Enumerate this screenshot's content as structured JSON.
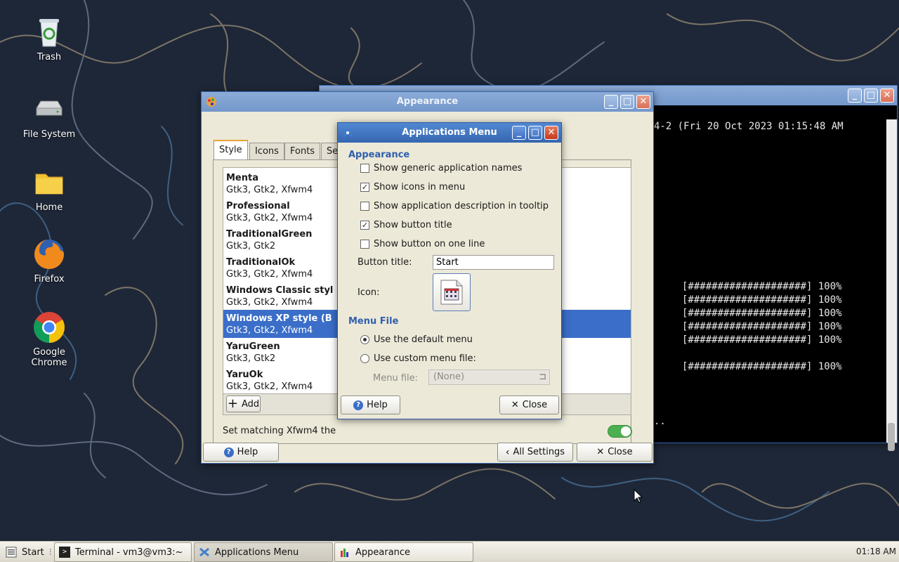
{
  "desktop": {
    "icons": [
      {
        "label": "Trash",
        "icon": "trash-icon"
      },
      {
        "label": "File System",
        "icon": "drive-icon"
      },
      {
        "label": "Home",
        "icon": "folder-icon"
      },
      {
        "label": "Firefox",
        "icon": "firefox-icon"
      },
      {
        "label": "Google Chrome",
        "icon": "chrome-icon"
      }
    ]
  },
  "terminal": {
    "header_line": "4-2 (Fri 20 Oct 2023 01:15:48 AM",
    "progress_lines": [
      "[####################] 100%",
      "[####################] 100%",
      "[####################] 100%",
      "[####################] 100%",
      "[####################] 100%"
    ],
    "progress_line_last": "[####################] 100%",
    "ellipsis": ".."
  },
  "appearance": {
    "title": "Appearance",
    "tabs": [
      "Style",
      "Icons",
      "Fonts",
      "Se"
    ],
    "themes": [
      {
        "name": "Menta",
        "sub": "Gtk3, Gtk2, Xfwm4"
      },
      {
        "name": "Professional",
        "sub": "Gtk3, Gtk2, Xfwm4"
      },
      {
        "name": "TraditionalGreen",
        "sub": "Gtk3, Gtk2"
      },
      {
        "name": "TraditionalOk",
        "sub": "Gtk3, Gtk2, Xfwm4"
      },
      {
        "name": "Windows Classic styl",
        "sub": "Gtk3, Gtk2, Xfwm4"
      },
      {
        "name": "Windows XP style (B",
        "sub": "Gtk3, Gtk2, Xfwm4"
      },
      {
        "name": "YaruGreen",
        "sub": "Gtk3, Gtk2"
      },
      {
        "name": "YaruOk",
        "sub": "Gtk3, Gtk2, Xfwm4"
      }
    ],
    "selected_theme": "Windows XP style (B",
    "add_label": "Add",
    "matching_label": "Set matching Xfwm4 the",
    "matching_enabled": true,
    "help_label": "Help",
    "all_settings_label": "All Settings",
    "close_label": "Close"
  },
  "dialog": {
    "title": "Applications Menu",
    "section_appearance": "Appearance",
    "options": [
      {
        "label": "Show generic application names",
        "checked": false
      },
      {
        "label": "Show icons in menu",
        "checked": true
      },
      {
        "label": "Show application description in tooltip",
        "checked": false
      },
      {
        "label": "Show button title",
        "checked": true
      },
      {
        "label": "Show button on one line",
        "checked": false
      }
    ],
    "button_title_label": "Button title:",
    "button_title_value": "Start",
    "icon_label": "Icon:",
    "section_menu_file": "Menu File",
    "radio_default": "Use the default menu",
    "radio_custom": "Use custom menu file:",
    "menu_file_label": "Menu file:",
    "menu_file_value": "(None)",
    "help_label": "Help",
    "close_label": "Close"
  },
  "taskbar": {
    "start_label": "Start",
    "tasks": [
      {
        "label": "Terminal - vm3@vm3:~",
        "icon": "terminal-icon"
      },
      {
        "label": "Applications Menu",
        "icon": "xfce-icon"
      },
      {
        "label": "Appearance",
        "icon": "appearance-icon"
      }
    ],
    "clock": "01:18 AM"
  },
  "colors": {
    "titlebar": "#3566b0",
    "selection": "#3a6ec8",
    "accent_text": "#2f5fae",
    "toggle_on": "#4caf50"
  }
}
